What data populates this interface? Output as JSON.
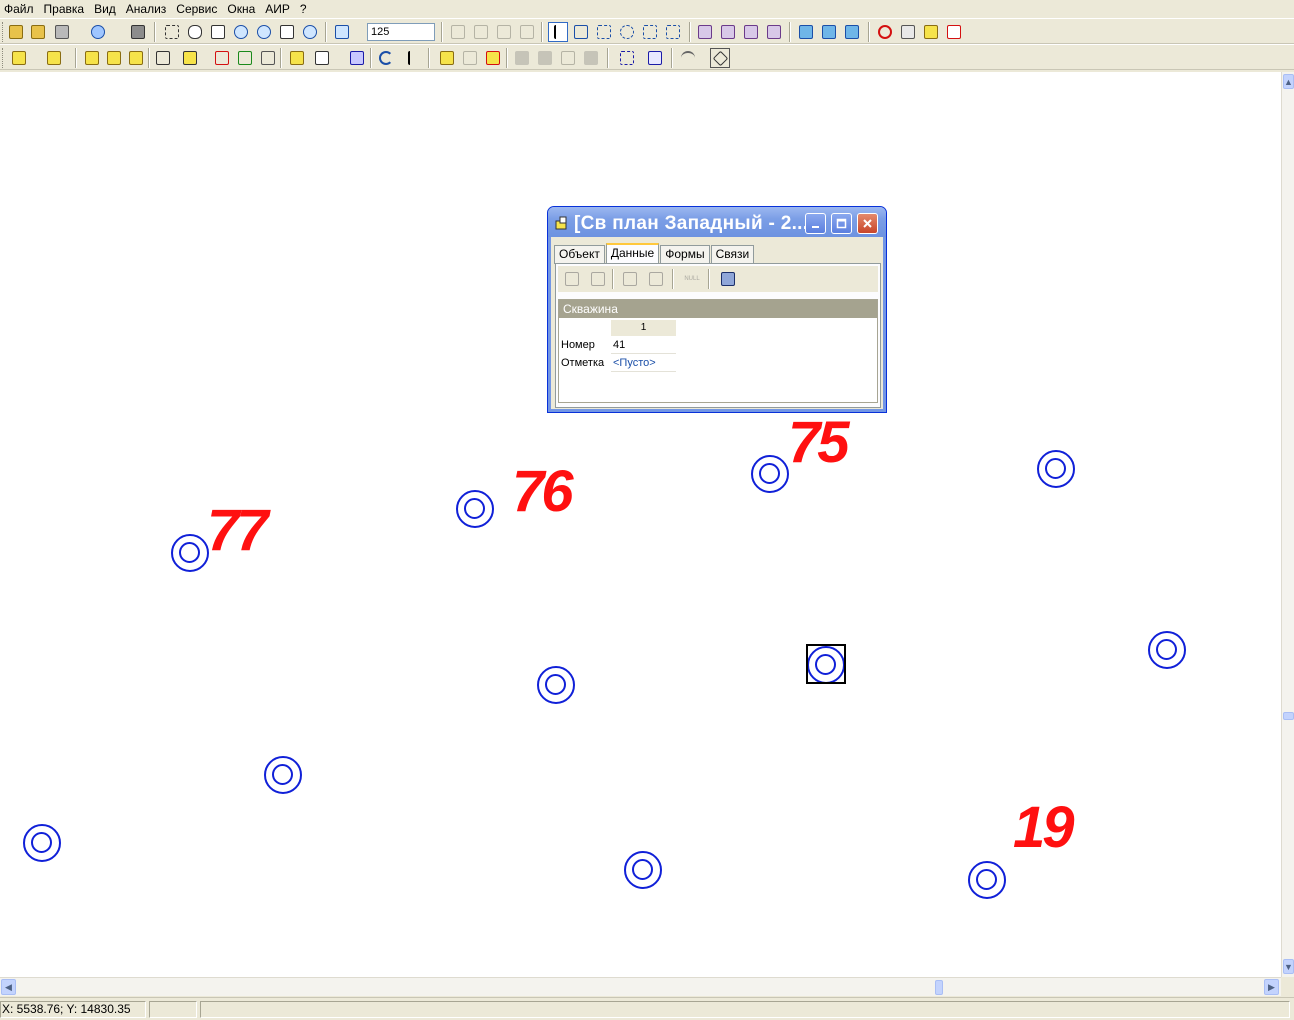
{
  "menu": [
    "Файл",
    "Правка",
    "Вид",
    "Анализ",
    "Сервис",
    "Окна",
    "АИР",
    "?"
  ],
  "toolbar": {
    "zoom_value": "125"
  },
  "map": {
    "wells": [
      {
        "id": "w1"
      },
      {
        "id": "w2"
      },
      {
        "id": "w3"
      },
      {
        "id": "w4"
      },
      {
        "id": "w5"
      },
      {
        "id": "w6"
      },
      {
        "id": "w7"
      },
      {
        "id": "w8"
      },
      {
        "id": "w9"
      },
      {
        "id": "w10"
      },
      {
        "id": "w11"
      },
      {
        "id": "w12"
      }
    ],
    "labels": {
      "l75": "75",
      "l76": "76",
      "l77": "77",
      "l19": "19"
    },
    "colors": {
      "well": "#1020d8",
      "label": "#ff1010",
      "selection": "#000000"
    }
  },
  "prop_window": {
    "title": "[Св план Западный - 2...",
    "tabs": [
      "Объект",
      "Данные",
      "Формы",
      "Связи"
    ],
    "active_tab": "Данные",
    "null_label": "NULL",
    "grid": {
      "header": "Скважина",
      "column": "1",
      "rows": [
        {
          "name": "Номер",
          "value": "41"
        },
        {
          "name": "Отметка",
          "value": "<Пусто>"
        }
      ]
    }
  },
  "status": {
    "coords": "X: 5538.76; Y: 14830.35"
  }
}
